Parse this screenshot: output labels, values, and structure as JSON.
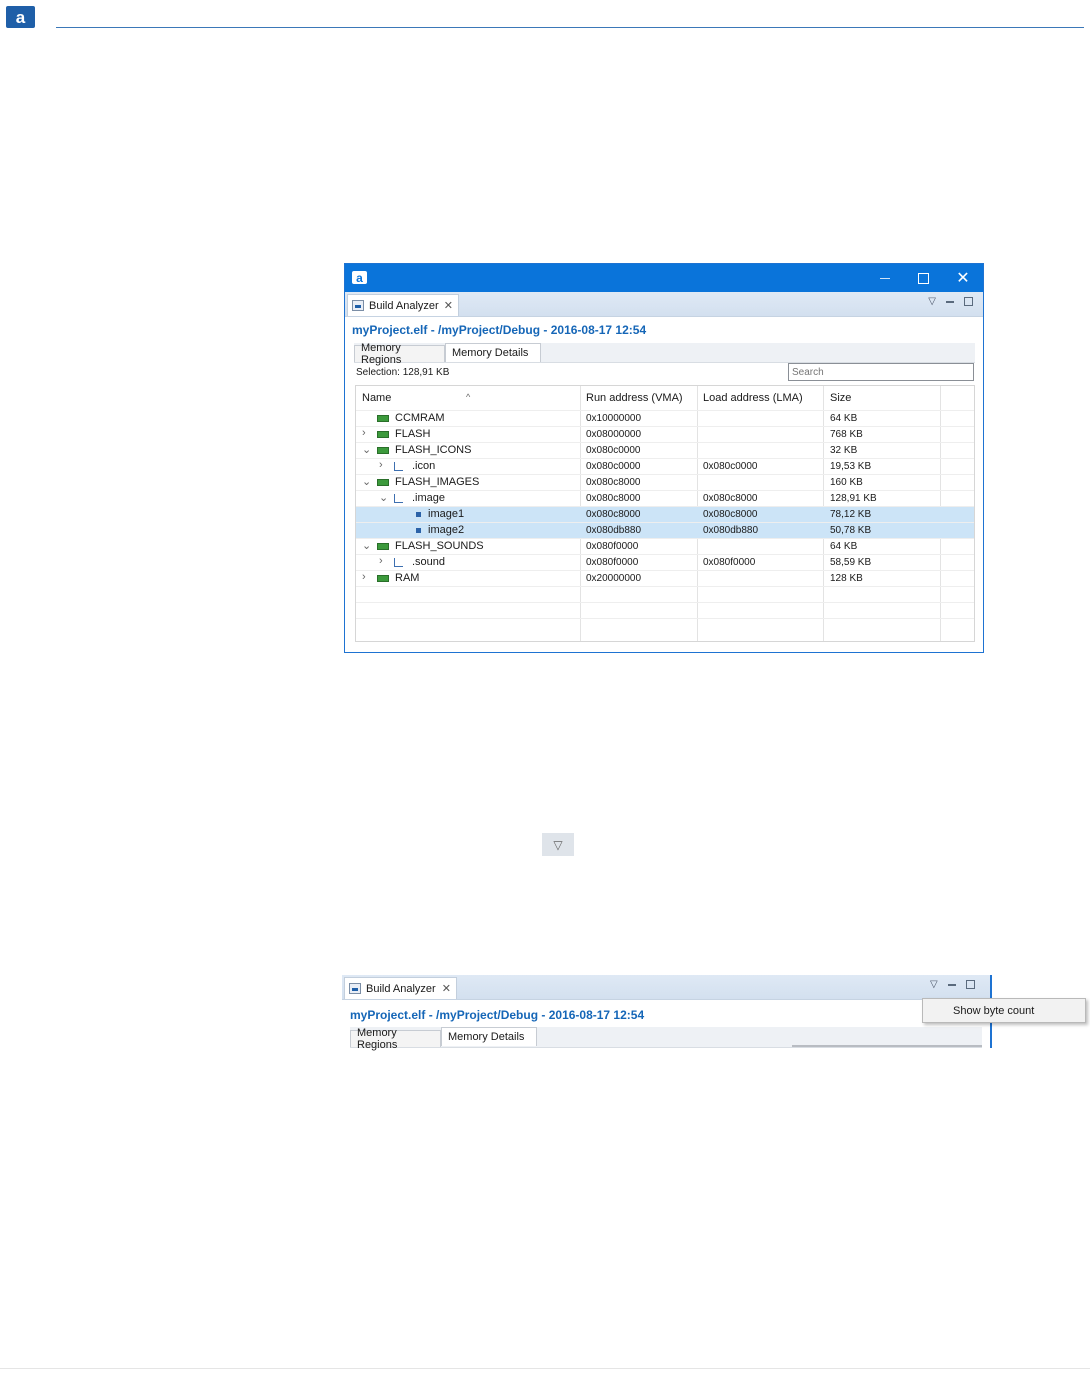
{
  "page": {
    "logo_letter": "a"
  },
  "window": {
    "app_icon_letter": "a",
    "view_tab": {
      "label": "Build Analyzer",
      "close": "✕"
    },
    "title": "myProject.elf - /myProject/Debug - 2016-08-17 12:54",
    "tabs": [
      "Memory Regions",
      "Memory Details"
    ],
    "active_tab": "Memory Details",
    "selection": "Selection: 128,91 KB",
    "search_placeholder": "Search",
    "columns": [
      "Name",
      "Run address (VMA)",
      "Load address (LMA)",
      "Size"
    ],
    "rows": [
      {
        "name": "CCMRAM",
        "vma": "0x10000000",
        "lma": "",
        "size": "64 KB",
        "level": 0,
        "icon": "memory-region-icon",
        "expander": "none",
        "selected": false
      },
      {
        "name": "FLASH",
        "vma": "0x08000000",
        "lma": "",
        "size": "768 KB",
        "level": 0,
        "icon": "memory-region-icon",
        "expander": "collapsed",
        "selected": false
      },
      {
        "name": "FLASH_ICONS",
        "vma": "0x080c0000",
        "lma": "",
        "size": "32 KB",
        "level": 0,
        "icon": "memory-region-icon",
        "expander": "expanded",
        "selected": false
      },
      {
        "name": ".icon",
        "vma": "0x080c0000",
        "lma": "0x080c0000",
        "size": "19,53 KB",
        "level": 1,
        "icon": "section-icon",
        "expander": "collapsed",
        "selected": false
      },
      {
        "name": "FLASH_IMAGES",
        "vma": "0x080c8000",
        "lma": "",
        "size": "160 KB",
        "level": 0,
        "icon": "memory-region-icon",
        "expander": "expanded",
        "selected": false
      },
      {
        "name": ".image",
        "vma": "0x080c8000",
        "lma": "0x080c8000",
        "size": "128,91 KB",
        "level": 1,
        "icon": "section-icon",
        "expander": "expanded",
        "selected": false
      },
      {
        "name": "image1",
        "vma": "0x080c8000",
        "lma": "0x080c8000",
        "size": "78,12 KB",
        "level": 2,
        "icon": "symbol-icon",
        "expander": "none",
        "selected": true
      },
      {
        "name": "image2",
        "vma": "0x080db880",
        "lma": "0x080db880",
        "size": "50,78 KB",
        "level": 2,
        "icon": "symbol-icon",
        "expander": "none",
        "selected": true
      },
      {
        "name": "FLASH_SOUNDS",
        "vma": "0x080f0000",
        "lma": "",
        "size": "64 KB",
        "level": 0,
        "icon": "memory-region-icon",
        "expander": "expanded",
        "selected": false
      },
      {
        "name": ".sound",
        "vma": "0x080f0000",
        "lma": "0x080f0000",
        "size": "58,59 KB",
        "level": 1,
        "icon": "section-icon",
        "expander": "collapsed",
        "selected": false
      },
      {
        "name": "RAM",
        "vma": "0x20000000",
        "lma": "",
        "size": "128 KB",
        "level": 0,
        "icon": "memory-region-icon",
        "expander": "collapsed",
        "selected": false
      }
    ]
  },
  "snippet": {
    "view_tab": {
      "label": "Build Analyzer",
      "close": "✕"
    },
    "title": "myProject.elf - /myProject/Debug - 2016-08-17 12:54",
    "tabs": [
      "Memory Regions",
      "Memory Details"
    ],
    "menu_item": "Show byte count"
  },
  "colors": {
    "accent": "#0a74da",
    "title_blue": "#1566b7",
    "selection": "#cce4f7"
  }
}
